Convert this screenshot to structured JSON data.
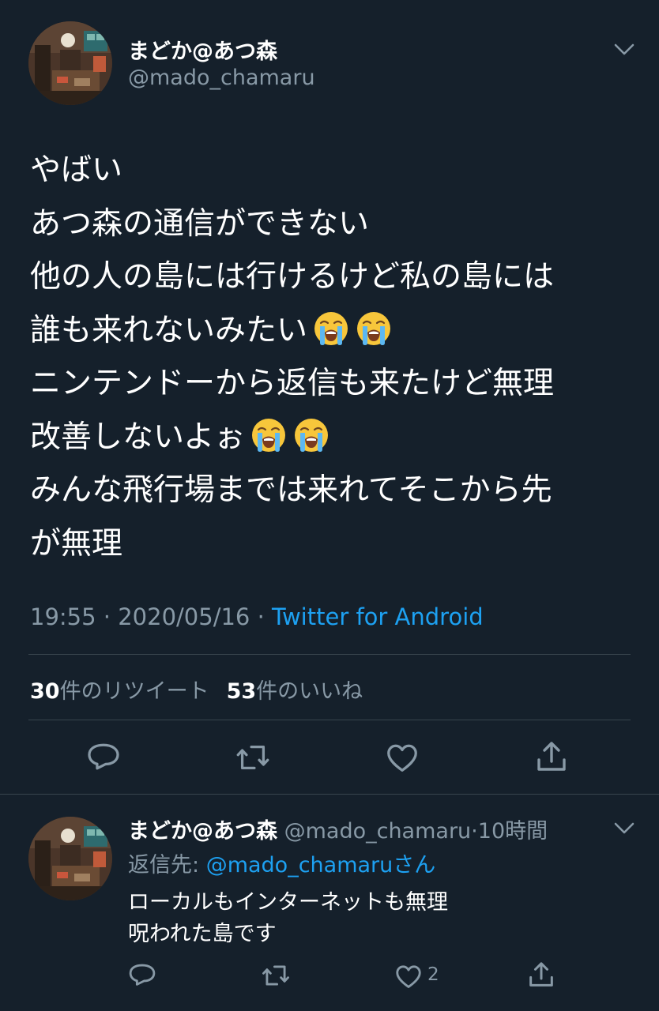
{
  "main_tweet": {
    "display_name": "まどか@あつ森",
    "handle": "@mado_chamaru",
    "body_lines": [
      "やばい",
      "あつ森の通信ができない",
      "他の人の島には行けるけど私の島には",
      "誰も来れないみたい",
      "ニンテンドーから返信も来たけど無理",
      "改善しないよぉ",
      "みんな飛行場までは来れてそこから先",
      "が無理"
    ],
    "emoji": "loudly-crying-face",
    "time": "19:55",
    "date": "2020/05/16",
    "separator": " · ",
    "source": "Twitter for Android",
    "retweet_count": "30",
    "retweet_label": "件のリツイート",
    "like_count": "53",
    "like_label": "件のいいね"
  },
  "reply_tweet": {
    "display_name": "まどか@あつ森",
    "handle": "@mado_chamaru",
    "time_ago": "10時間",
    "separator": "·",
    "reply_to_label": "返信先: ",
    "reply_to_mention": "@mado_chamaruさん",
    "body_lines": [
      "ローカルもインターネットも無理",
      "呪われた島です"
    ],
    "like_count": "2"
  },
  "colors": {
    "background": "#15202b",
    "text_primary": "#ffffff",
    "text_secondary": "#8899a6",
    "accent": "#1da1f2",
    "divider": "#38444d"
  },
  "icons": {
    "reply": "reply-bubble-icon",
    "retweet": "retweet-icon",
    "like": "heart-icon",
    "share": "share-icon",
    "menu": "chevron-down-icon"
  }
}
